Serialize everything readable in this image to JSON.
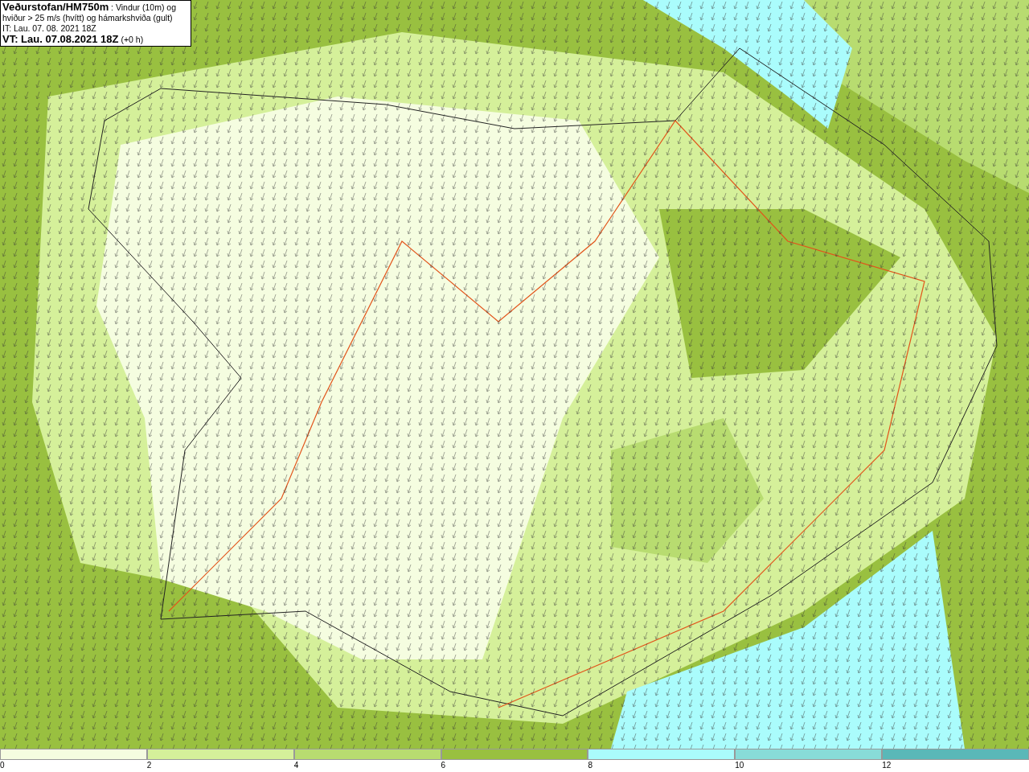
{
  "title_box": {
    "description": "**Veðurstofan/HM750m** : Vindur (10m) og hviður > 25 m/s (hvítt) og hámarkshviða (gult)",
    "issue_time": "IT: Lau. 07. 08. 2021 18Z",
    "valid_time": "**VT: Lau. 07.08.2021 18Z** (+0 h)"
  },
  "legend": [
    {
      "label": "0",
      "color": "#f5fde0"
    },
    {
      "label": "2",
      "color": "#d5f09a"
    },
    {
      "label": "4",
      "color": "#b8dc70"
    },
    {
      "label": "6",
      "color": "#99c040"
    },
    {
      "label": "8",
      "color": "#aafcfc"
    },
    {
      "label": "10",
      "color": "#88dcd8"
    },
    {
      "label": "12",
      "color": "#5ab8b8"
    }
  ]
}
